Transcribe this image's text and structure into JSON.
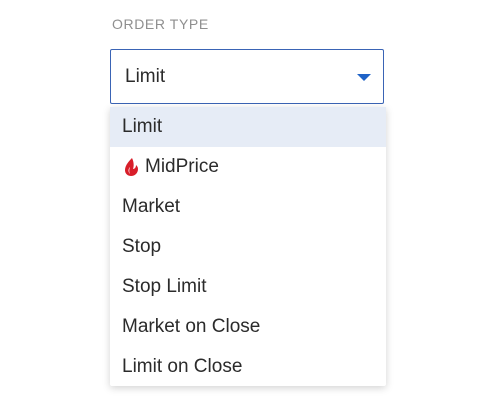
{
  "field": {
    "label": "ORDER TYPE",
    "selected_value": "Limit"
  },
  "dropdown": {
    "options": [
      {
        "label": "Limit",
        "selected": true
      },
      {
        "label": "MidPrice",
        "icon": "midprice-flame-icon"
      },
      {
        "label": "Market"
      },
      {
        "label": "Stop"
      },
      {
        "label": "Stop Limit"
      },
      {
        "label": "Market on Close"
      },
      {
        "label": "Limit on Close"
      }
    ]
  },
  "colors": {
    "accent": "#1f63c7",
    "selected_row_bg": "#e6ecf6",
    "midprice_icon": "#d81e2a",
    "label_gray": "#8f8f8f"
  }
}
